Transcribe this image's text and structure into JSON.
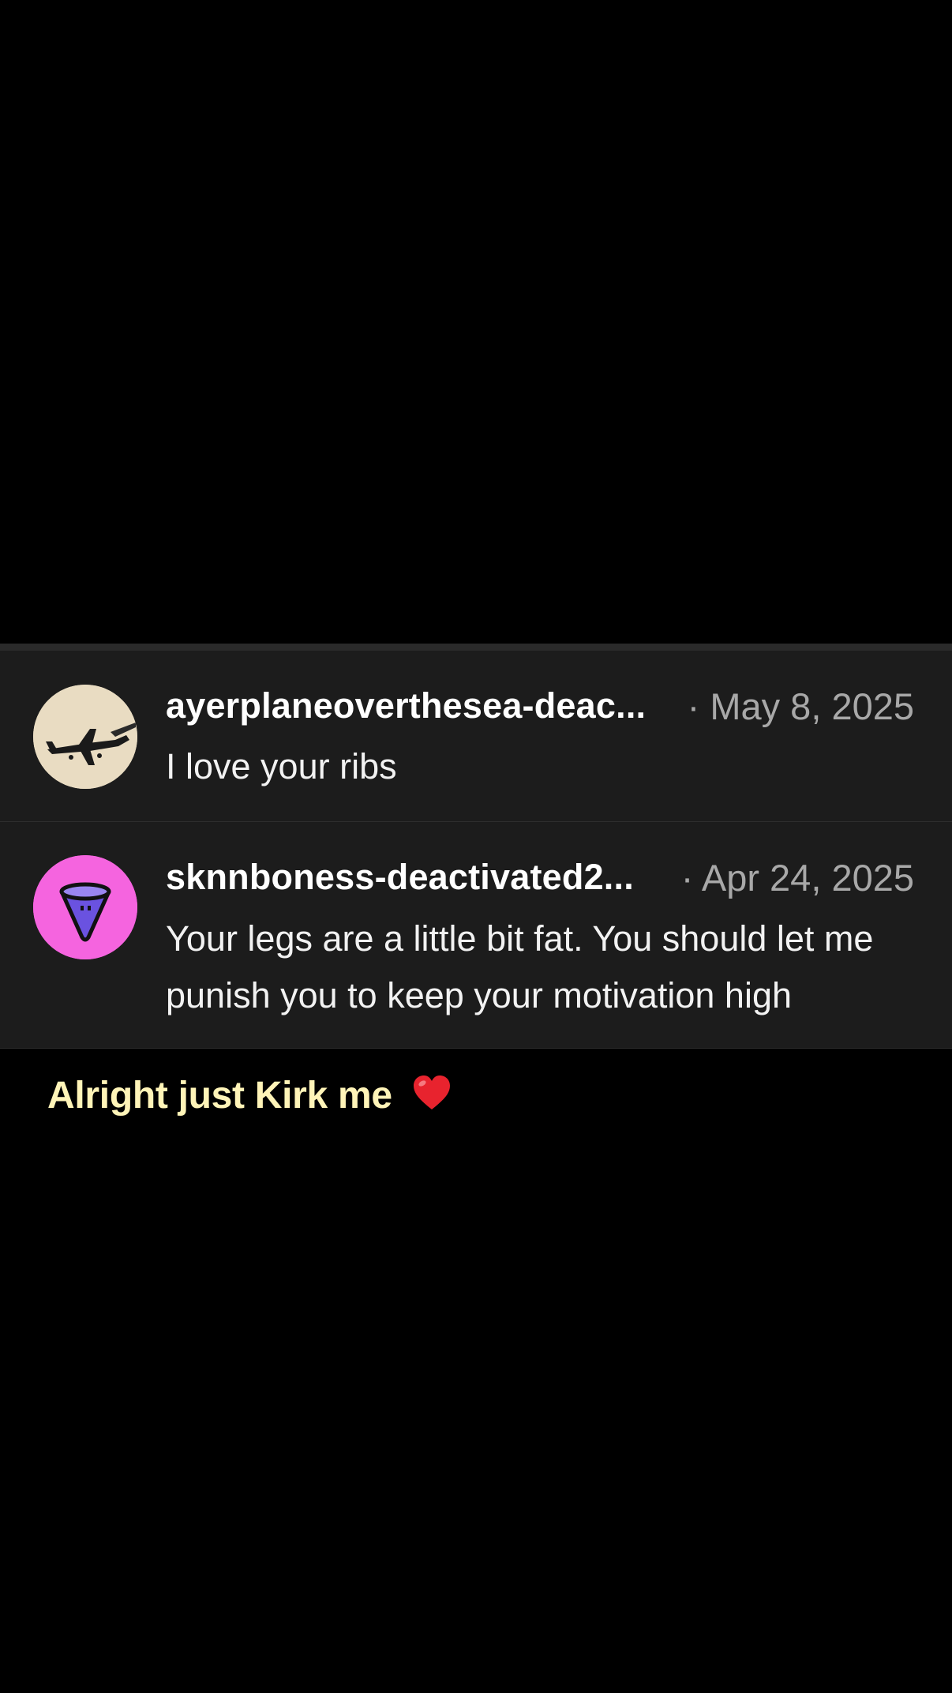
{
  "comments": [
    {
      "username": "ayerplaneoverthesea-deac...",
      "date": "· May 8, 2025",
      "text": "I love your ribs",
      "avatar_icon": "airplane-icon",
      "avatar_color": "#e9dcc2"
    },
    {
      "username": "sknnboness-deactivated2...",
      "date": "· Apr 24, 2025",
      "text": "Your legs are a little bit fat. You should let me punish you to keep your motivation high",
      "avatar_icon": "cone-icon",
      "avatar_color": "#f564df"
    }
  ],
  "caption": {
    "text": "Alright just Kirk me",
    "emoji_icon": "red-heart-icon",
    "color": "#fff4b8"
  }
}
